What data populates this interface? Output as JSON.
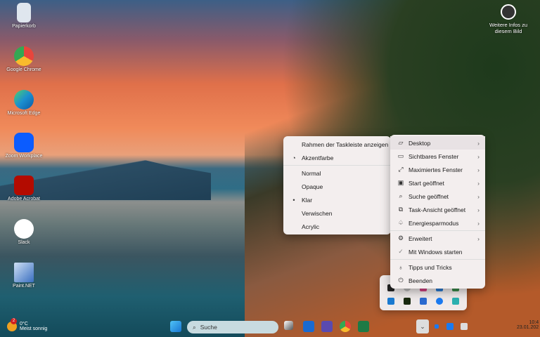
{
  "desktop": {
    "icons": [
      {
        "label": "Papierkorb",
        "color": "#cfd8e0"
      },
      {
        "label": "Google Chrome",
        "color": "#e8453c"
      },
      {
        "label": "Microsoft Edge",
        "color": "#1b8fd0"
      },
      {
        "label": "Zoom Workplace",
        "color": "#0b5cff"
      },
      {
        "label": "Adobe Acrobat",
        "color": "#b30b00"
      },
      {
        "label": "Slack",
        "color": "#ffffff"
      },
      {
        "label": "Paint.NET",
        "color": "#3a6fc0"
      }
    ],
    "info": "Weitere Infos zu diesem Bild"
  },
  "submenu": {
    "items": [
      "Rahmen der Taskleiste anzeigen",
      "Akzentfarbe",
      "Normal",
      "Opaque",
      "Klar",
      "Verwischen",
      "Acrylic"
    ],
    "selected": "Klar"
  },
  "menu": {
    "items": [
      {
        "label": "Desktop",
        "icon": "desktop-icon"
      },
      {
        "label": "Sichtbares Fenster",
        "icon": "window-icon"
      },
      {
        "label": "Maximiertes Fenster",
        "icon": "maximize-icon"
      },
      {
        "label": "Start geöffnet",
        "icon": "start-icon"
      },
      {
        "label": "Suche geöffnet",
        "icon": "search-icon"
      },
      {
        "label": "Task-Ansicht geöffnet",
        "icon": "taskview-icon"
      },
      {
        "label": "Energiesparmodus",
        "icon": "leaf-icon"
      },
      {
        "label": "Erweitert",
        "icon": "gear-icon"
      },
      {
        "label": "Mit Windows starten",
        "icon": "check-icon"
      },
      {
        "label": "Tipps und Tricks",
        "icon": "bulb-icon"
      },
      {
        "label": "Beenden",
        "icon": "power-icon"
      }
    ]
  },
  "taskbar": {
    "weather_temp": "0°C",
    "weather_desc": "Meist sonnig",
    "weather_badge": "2",
    "search_placeholder": "Suche",
    "clock_time": "10:4",
    "clock_date": "23.01.202"
  }
}
